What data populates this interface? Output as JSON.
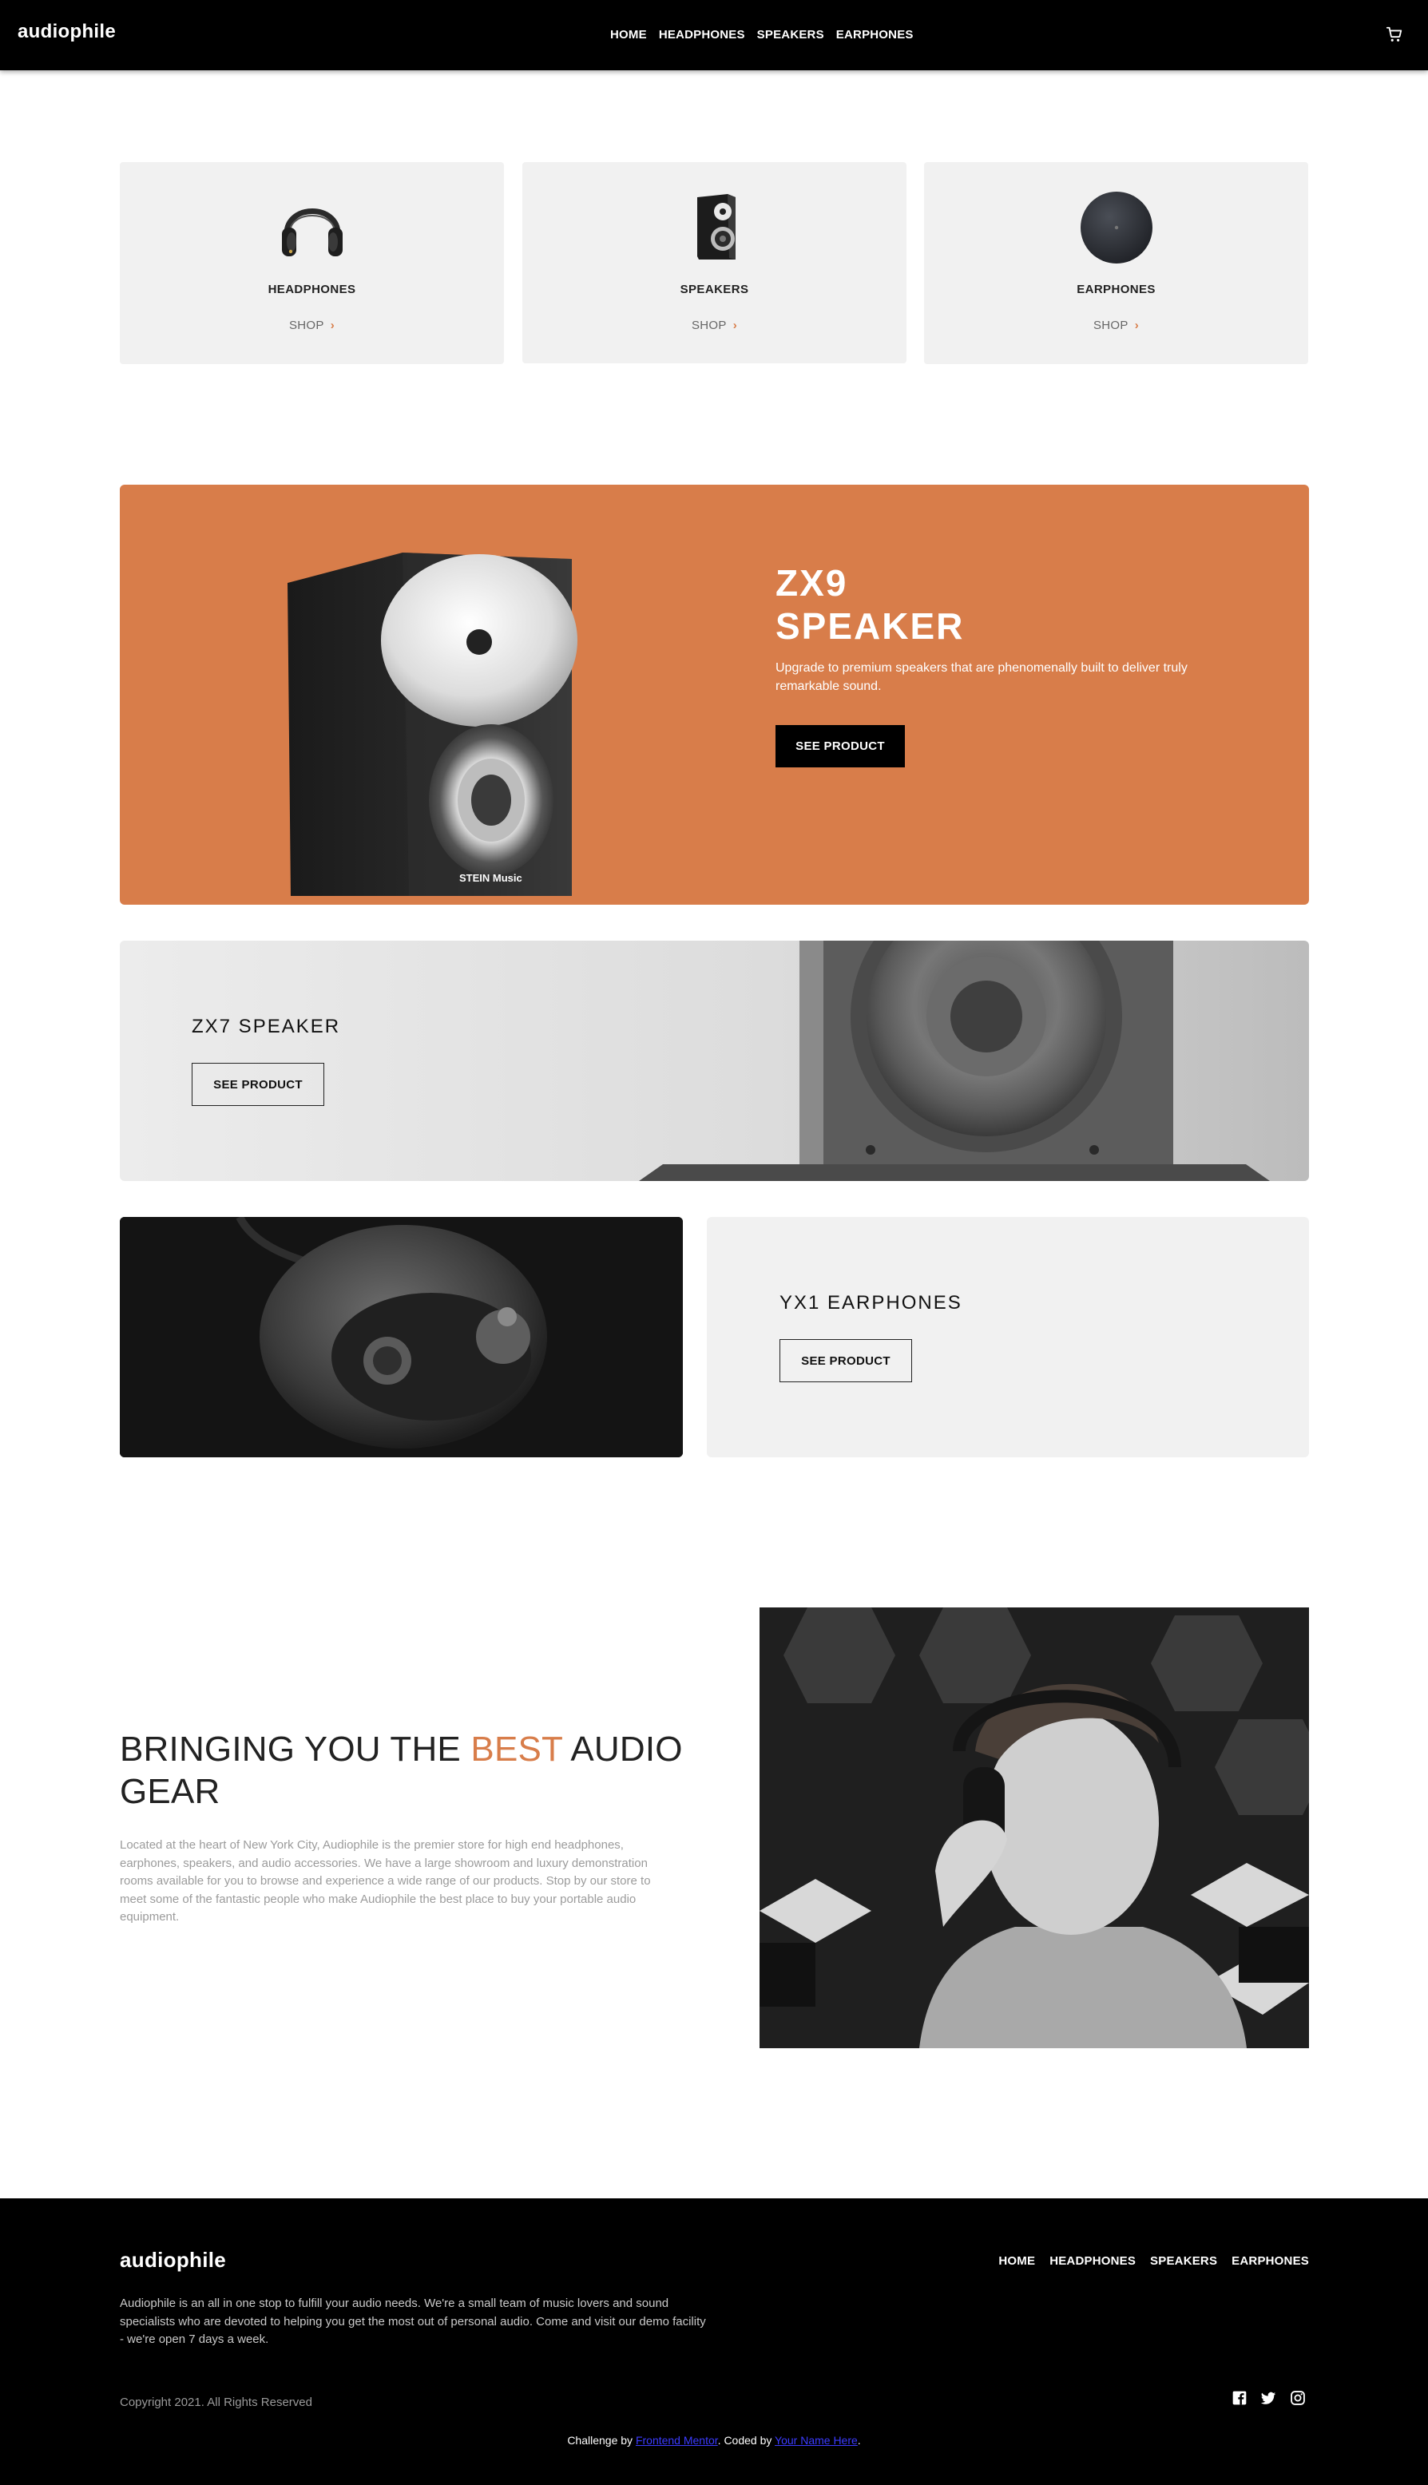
{
  "header": {
    "logo": "audiophile",
    "nav": [
      "HOME",
      "HEADPHONES",
      "SPEAKERS",
      "EARPHONES"
    ],
    "cart_icon": "cart-icon"
  },
  "categories": [
    {
      "name": "HEADPHONES",
      "shop": "SHOP",
      "chevron": "›"
    },
    {
      "name": "SPEAKERS",
      "shop": "SHOP",
      "chevron": "›"
    },
    {
      "name": "EARPHONES",
      "shop": "SHOP",
      "chevron": "›"
    }
  ],
  "zx9": {
    "title_line1": "ZX9",
    "title_line2": "SPEAKER",
    "description": "Upgrade to premium speakers that are phenomenally built to deliver truly remarkable sound.",
    "button": "SEE PRODUCT",
    "brand_mark": "STEIN Music",
    "bg_color": "#d87d4a"
  },
  "zx7": {
    "title": "ZX7 SPEAKER",
    "button": "SEE PRODUCT"
  },
  "yx1": {
    "title": "YX1 EARPHONES",
    "button": "SEE PRODUCT"
  },
  "about": {
    "title_before": "BRINGING YOU THE ",
    "title_accent": "BEST",
    "title_after": " AUDIO GEAR",
    "body": "Located at the heart of New York City, Audiophile is the premier store for high end headphones, earphones, speakers, and audio accessories. We have a large showroom and luxury demonstration rooms available for you to browse and experience a wide range of our products. Stop by our store to meet some of the fantastic people who make Audiophile the best place to buy your portable audio equipment."
  },
  "footer": {
    "logo": "audiophile",
    "nav": [
      "HOME",
      "HEADPHONES",
      "SPEAKERS",
      "EARPHONES"
    ],
    "description": "Audiophile is an all in one stop to fulfill your audio needs. We're a small team of music lovers and sound specialists who are devoted to helping you get the most out of personal audio. Come and visit our demo facility - we're open 7 days a week.",
    "copyright": "Copyright 2021. All Rights Reserved",
    "social": [
      "facebook-icon",
      "twitter-icon",
      "instagram-icon"
    ],
    "credit_prefix": "Challenge by ",
    "credit_link1": "Frontend Mentor",
    "credit_middle": ". Coded by ",
    "credit_link2": "Your Name Here",
    "credit_suffix": "."
  },
  "colors": {
    "accent": "#d87d4a",
    "dark": "#000000",
    "light_bg": "#f1f1f1"
  }
}
